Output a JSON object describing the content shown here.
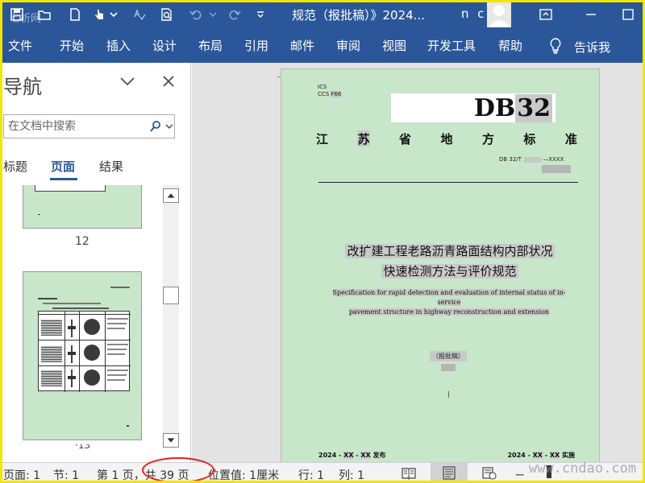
{
  "window": {
    "title": "规范（报批稿）》2024...",
    "user_initials": "n c",
    "top_watermark": "七析网"
  },
  "ribbon": {
    "tabs": [
      "文件",
      "开始",
      "插入",
      "设计",
      "布局",
      "引用",
      "邮件",
      "审阅",
      "视图",
      "开发工具",
      "帮助"
    ],
    "tell_me": "告诉我"
  },
  "nav_pane": {
    "title": "导航",
    "search_placeholder": "在文档中搜索",
    "tabs": [
      "标题",
      "页面",
      "结果"
    ],
    "active_tab": "页面",
    "page_numbers": [
      "12"
    ]
  },
  "document": {
    "ics": "ICS",
    "ccs": "CCS",
    "ccs_code": "F66",
    "standard_prefix": "DB",
    "standard_num": "32",
    "province_chars": [
      "江",
      "苏",
      "省",
      "地",
      "方",
      "标",
      "准"
    ],
    "db_number_prefix": "DB 32/T",
    "db_number_suffix": "—XXXX",
    "title_line1": "改扩建工程老路沥青路面结构内部状况",
    "title_line2": "快速检测方法与评价规范",
    "english_line1": "Specification for rapid detection and evaluation of internal status of in-service",
    "english_line2": "pavement structure in highway reconstruction and extension",
    "draft_label": "（报批稿）",
    "publish": {
      "year": "2024",
      "mm": "XX",
      "dd": "XX",
      "label": "发布"
    },
    "implement": {
      "year": "2024",
      "mm": "XX",
      "dd": "XX",
      "label": "实施"
    }
  },
  "status_bar": {
    "page": "页面: 1",
    "section": "节: 1",
    "page_of": "第 1 页，共 39 页",
    "position": "位置值: 1厘米",
    "line": "行: 1",
    "column": "列: 1",
    "watermark": "www.cndao.com"
  },
  "colors": {
    "ribbon_blue": "#2b579a",
    "page_green": "#c8e6c9",
    "highlight_gray": "#c9c9c9",
    "annotation_red": "#e02020"
  }
}
